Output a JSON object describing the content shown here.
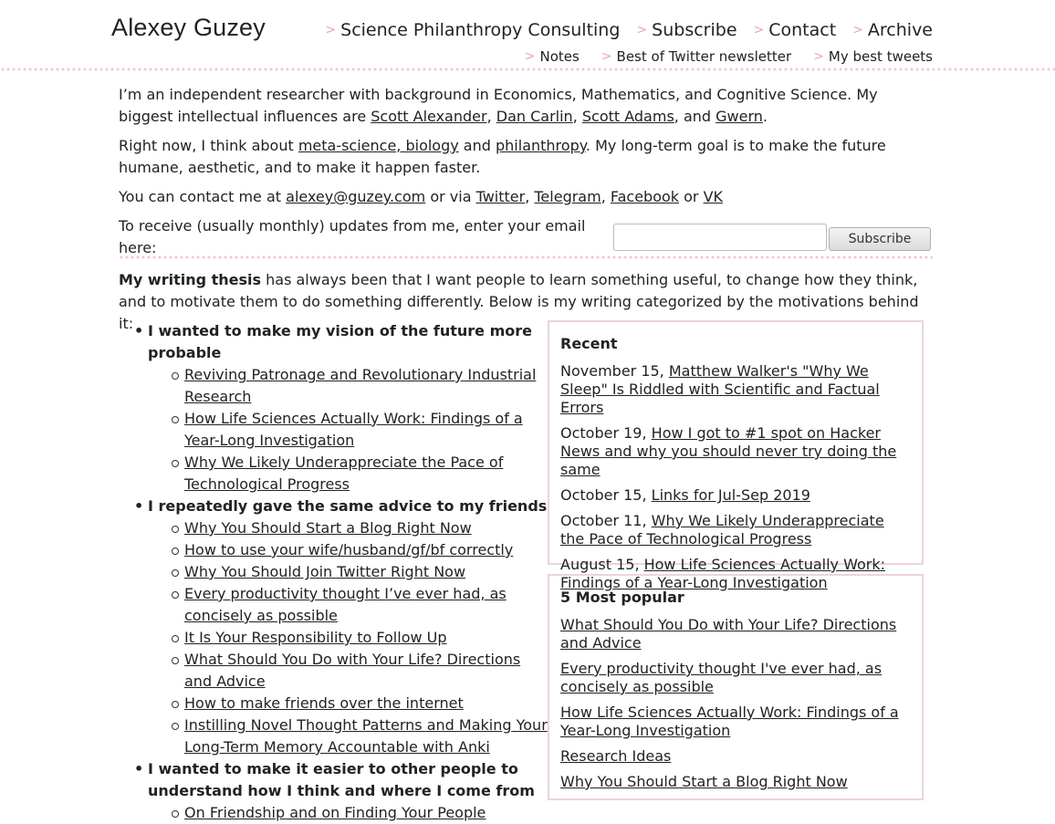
{
  "header": {
    "title": "Alexey Guzey",
    "nav_main": [
      "Science Philanthropy Consulting",
      "Subscribe",
      "Contact",
      "Archive"
    ],
    "nav_sub": [
      "Notes",
      "Best of Twitter newsletter",
      "My best tweets"
    ]
  },
  "intro": {
    "p1": {
      "t1": "I’m an independent researcher with background in Economics, Mathematics, and Cognitive Science. My biggest intellectual influences are ",
      "l1": "Scott Alexander",
      "t2": ", ",
      "l2": "Dan Carlin",
      "t3": ", ",
      "l3": "Scott Adams",
      "t4": ", and ",
      "l4": "Gwern",
      "t5": "."
    },
    "p2": {
      "t1": "Right now, I think about ",
      "l1": "meta-science, biology",
      "t2": " and ",
      "l2": "philanthropy",
      "t3": ". My long-term goal is to make the future humane, aesthetic, and to make it happen faster."
    },
    "p3": {
      "t1": "You can contact me at ",
      "l1": "alexey@guzey.com",
      "t2": " or via ",
      "l2": "Twitter",
      "t3": ", ",
      "l3": "Telegram",
      "t4": ", ",
      "l4": "Facebook",
      "t5": " or ",
      "l5": "VK"
    },
    "signup_label": "To receive (usually monthly) updates from me, enter your email here:",
    "signup_button": "Subscribe"
  },
  "thesis": {
    "bold": "My writing thesis",
    "rest": " has always been that I want people to learn something useful, to change how they think, and to motivate them to do something differently. Below is my writing categorized by the motivations behind it:"
  },
  "categories": [
    {
      "label": "I wanted to make my vision of the future more probable",
      "posts": [
        "Reviving Patronage and Revolutionary Industrial Research",
        "How Life Sciences Actually Work: Findings of a Year-Long Investigation",
        "Why We Likely Underappreciate the Pace of Technological Progress"
      ]
    },
    {
      "label": "I repeatedly gave the same advice to my friends",
      "posts": [
        "Why You Should Start a Blog Right Now",
        "How to use your wife/husband/gf/bf correctly",
        "Why You Should Join Twitter Right Now",
        "Every productivity thought I’ve ever had, as concisely as possible",
        "It Is Your Responsibility to Follow Up",
        "What Should You Do with Your Life? Directions and Advice",
        "How to make friends over the internet",
        "Instilling Novel Thought Patterns and Making Your Long-Term Memory Accountable with Anki"
      ]
    },
    {
      "label": "I wanted to make it easier to other people to understand how I think and where I come from",
      "posts": [
        "On Friendship and on Finding Your People"
      ]
    }
  ],
  "recent": {
    "heading": "Recent",
    "items": [
      {
        "date": "November 15, ",
        "title": "Matthew Walker's \"Why We Sleep\" Is Riddled with Scientific and Factual Errors"
      },
      {
        "date": "October 19, ",
        "title": "How I got to #1 spot on Hacker News and why you should never try doing the same"
      },
      {
        "date": "October 15, ",
        "title": "Links for Jul-Sep 2019"
      },
      {
        "date": "October 11, ",
        "title": "Why We Likely Underappreciate the Pace of Technological Progress"
      },
      {
        "date": "August 15, ",
        "title": "How Life Sciences Actually Work: Findings of a Year-Long Investigation"
      }
    ]
  },
  "popular": {
    "heading": "5 Most popular",
    "items": [
      "What Should You Do with Your Life? Directions and Advice",
      "Every productivity thought I've ever had, as concisely as possible",
      "How Life Sciences Actually Work: Findings of a Year-Long Investigation",
      "Research Ideas",
      "Why You Should Start a Blog Right Now"
    ]
  },
  "colors": {
    "accent": "#e5a7b4",
    "separator": "#f1c4ce",
    "box_border": "#ecd3da"
  }
}
